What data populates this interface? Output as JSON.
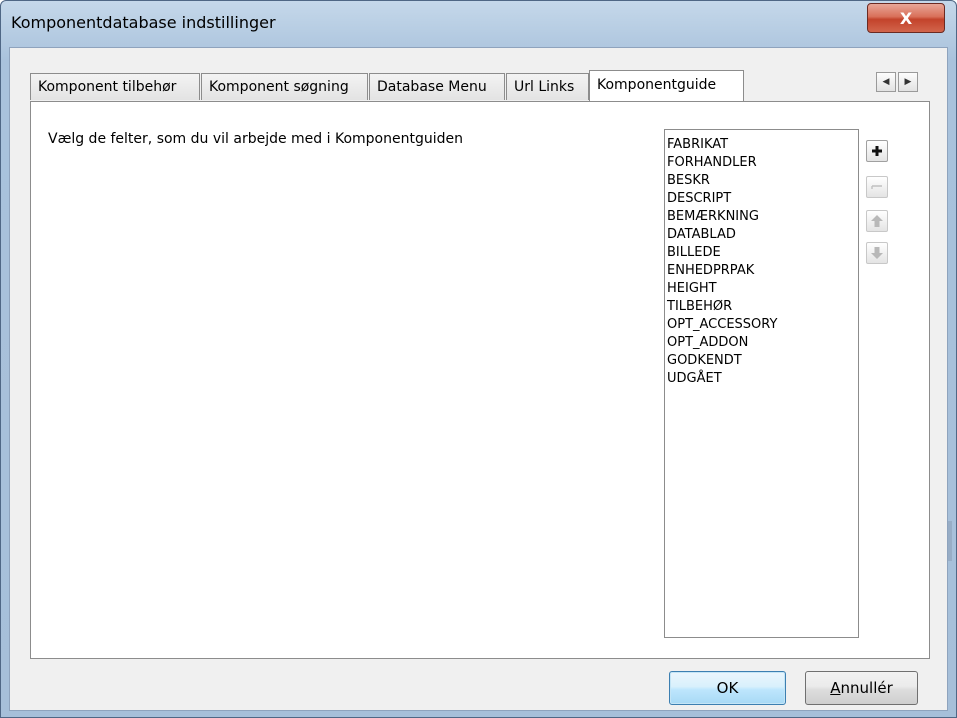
{
  "window": {
    "title": "Komponentdatabase indstillinger",
    "close_glyph": "X"
  },
  "tabs": [
    {
      "label": "Komponent tilbehør",
      "active": false
    },
    {
      "label": "Komponent søgning",
      "active": false
    },
    {
      "label": "Database Menu",
      "active": false
    },
    {
      "label": "Url Links",
      "active": false
    },
    {
      "label": "Komponentguide",
      "active": true
    }
  ],
  "tab_scroll": {
    "left_icon": "arrow-left-icon",
    "right_icon": "arrow-right-icon"
  },
  "panel": {
    "instruction": "Vælg de felter, som du vil arbejde med i Komponentguiden",
    "fields": [
      "FABRIKAT",
      "FORHANDLER",
      "BESKR",
      "DESCRIPT",
      "BEMÆRKNING",
      "DATABLAD",
      "BILLEDE",
      "ENHEDPRPAK",
      "HEIGHT",
      "TILBEHØR",
      "OPT_ACCESSORY",
      "OPT_ADDON",
      "GODKENDT",
      "UDGÅET"
    ],
    "side_buttons": [
      {
        "icon": "plus-icon",
        "enabled": true
      },
      {
        "icon": "minus-icon",
        "enabled": false
      },
      {
        "icon": "arrow-up-icon",
        "enabled": false
      },
      {
        "icon": "arrow-down-icon",
        "enabled": false
      }
    ]
  },
  "buttons": {
    "ok": "OK",
    "cancel": "Annullér"
  },
  "colors": {
    "title_bar": "#b7cde3",
    "close_button": "#c3432b",
    "ok_button": "#bee6fd"
  }
}
